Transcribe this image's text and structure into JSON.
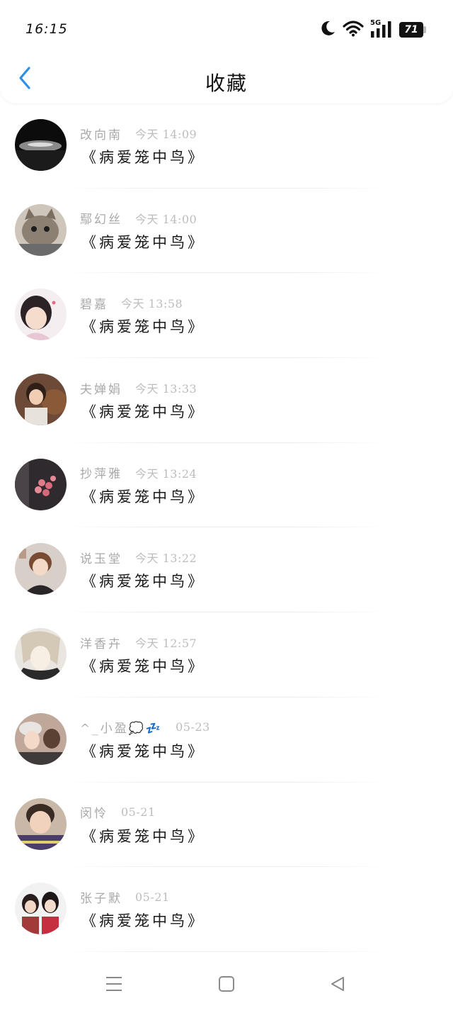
{
  "status_bar": {
    "time": "16:15",
    "network": "5G",
    "battery": "71"
  },
  "header": {
    "title": "收藏"
  },
  "favorites": [
    {
      "user": "改向南",
      "date": "今天 14:09",
      "title": "《病爱笼中鸟》"
    },
    {
      "user": "鄢幻丝",
      "date": "今天 14:00",
      "title": "《病爱笼中鸟》"
    },
    {
      "user": "碧嘉",
      "date": "今天 13:58",
      "title": "《病爱笼中鸟》"
    },
    {
      "user": "夫婵娟",
      "date": "今天 13:33",
      "title": "《病爱笼中鸟》"
    },
    {
      "user": "抄萍雅",
      "date": "今天 13:24",
      "title": "《病爱笼中鸟》"
    },
    {
      "user": "说玉堂",
      "date": "今天 13:22",
      "title": "《病爱笼中鸟》"
    },
    {
      "user": "洋香卉",
      "date": "今天 12:57",
      "title": "《病爱笼中鸟》"
    },
    {
      "user": "^_小盈💭💤",
      "date": "05-23",
      "title": "《病爱笼中鸟》"
    },
    {
      "user": "闵怜",
      "date": "05-21",
      "title": "《病爱笼中鸟》"
    },
    {
      "user": "张子默",
      "date": "05-21",
      "title": "《病爱笼中鸟》"
    }
  ],
  "colors": {
    "accent": "#2f8fe6",
    "username": "#a9a9a9",
    "date": "#bdbdbd",
    "title": "#1a1a1a"
  }
}
